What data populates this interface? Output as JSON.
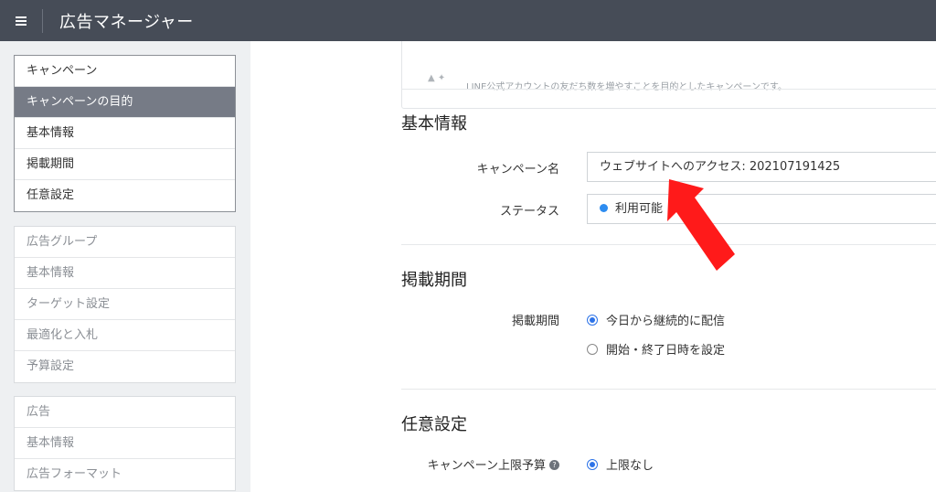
{
  "header": {
    "title": "広告マネージャー",
    "menu_icon": "hamburger-icon"
  },
  "sidebar": {
    "campaign_group": {
      "items": [
        {
          "label": "キャンペーン",
          "selected": false
        },
        {
          "label": "キャンペーンの目的",
          "selected": true
        },
        {
          "label": "基本情報",
          "selected": false
        },
        {
          "label": "掲載期間",
          "selected": false
        },
        {
          "label": "任意設定",
          "selected": false
        }
      ]
    },
    "adgroup_group": {
      "items": [
        {
          "label": "広告グループ"
        },
        {
          "label": "基本情報"
        },
        {
          "label": "ターゲット設定"
        },
        {
          "label": "最適化と入札"
        },
        {
          "label": "予算設定"
        }
      ]
    },
    "ad_group": {
      "items": [
        {
          "label": "広告"
        },
        {
          "label": "基本情報"
        },
        {
          "label": "広告フォーマット"
        }
      ]
    }
  },
  "objective_card": {
    "description": "LINE公式アカウントの友だち数を増やすことを目的としたキャンペーンです。"
  },
  "basic_info": {
    "title": "基本情報",
    "campaign_name_label": "キャンペーン名",
    "campaign_name_value": "ウェブサイトへのアクセス: 202107191425",
    "status_label": "ステータス",
    "status_value": "利用可能",
    "status_color": "#2d8cf0"
  },
  "schedule": {
    "title": "掲載期間",
    "label": "掲載期間",
    "options": [
      {
        "label": "今日から継続的に配信",
        "checked": true
      },
      {
        "label": "開始・終了日時を設定",
        "checked": false
      }
    ]
  },
  "optional": {
    "title": "任意設定",
    "budget_label": "キャンペーン上限予算",
    "help_icon": "question-circle-icon",
    "budget_option": {
      "label": "上限なし",
      "checked": true
    }
  },
  "annotation": {
    "arrow_color": "#ff1a1a",
    "arrow_icon": "red-pointer-arrow"
  }
}
